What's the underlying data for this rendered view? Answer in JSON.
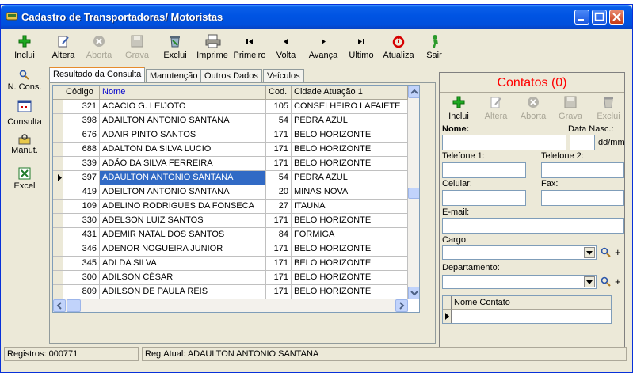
{
  "window": {
    "title": "Cadastro de Transportadoras/ Motoristas"
  },
  "colors": {
    "title_bar": "#0054e3",
    "selection": "#316ac5",
    "contatos_title": "#ff0000",
    "add_icon": "#1ea821",
    "refresh_icon": "#d60000"
  },
  "toolbar": [
    {
      "label": "Inclui",
      "icon": "plus-icon",
      "enabled": true
    },
    {
      "label": "Altera",
      "icon": "edit-icon",
      "enabled": true
    },
    {
      "label": "Aborta",
      "icon": "cancel-icon",
      "enabled": false
    },
    {
      "label": "Grava",
      "icon": "save-icon",
      "enabled": false
    },
    {
      "label": "Exclui",
      "icon": "trash-icon",
      "enabled": true
    },
    {
      "label": "Imprime",
      "icon": "printer-icon",
      "enabled": true
    },
    {
      "label": "Primeiro",
      "icon": "first-icon",
      "enabled": true
    },
    {
      "label": "Volta",
      "icon": "prev-icon",
      "enabled": true
    },
    {
      "label": "Avança",
      "icon": "next-icon",
      "enabled": true
    },
    {
      "label": "Ultimo",
      "icon": "last-icon",
      "enabled": true
    },
    {
      "label": "Atualiza",
      "icon": "refresh-icon",
      "enabled": true
    },
    {
      "label": "Sair",
      "icon": "exit-icon",
      "enabled": true
    }
  ],
  "nav": [
    {
      "label": "N. Cons.",
      "icon": "search-icon"
    },
    {
      "label": "Consulta",
      "icon": "window-icon"
    },
    {
      "label": "Manut.",
      "icon": "tools-icon"
    },
    {
      "label": "Excel",
      "icon": "excel-icon"
    }
  ],
  "tabs": [
    "Resultado da Consulta",
    "Manutenção",
    "Outros Dados",
    "Veículos"
  ],
  "grid": {
    "columns": [
      "Código",
      "Nome",
      "Cod.",
      "Cidade Atuação 1"
    ],
    "rows": [
      [
        "321",
        "ACACIO G. LEIJOTO",
        "105",
        "CONSELHEIRO LAFAIETE"
      ],
      [
        "398",
        "ADAILTON ANTONIO SANTANA",
        "54",
        "PEDRA AZUL"
      ],
      [
        "676",
        "ADAIR PINTO SANTOS",
        "171",
        "BELO HORIZONTE"
      ],
      [
        "688",
        "ADALTON DA SILVA LUCIO",
        "171",
        "BELO HORIZONTE"
      ],
      [
        "339",
        "ADÃO DA SILVA FERREIRA",
        "171",
        "BELO HORIZONTE"
      ],
      [
        "397",
        "ADAULTON ANTONIO SANTANA",
        "54",
        "PEDRA AZUL"
      ],
      [
        "419",
        "ADEILTON ANTONIO SANTANA",
        "20",
        "MINAS NOVA"
      ],
      [
        "109",
        "ADELINO RODRIGUES DA FONSECA",
        "27",
        "ITAUNA"
      ],
      [
        "330",
        "ADELSON LUIZ SANTOS",
        "171",
        "BELO HORIZONTE"
      ],
      [
        "431",
        "ADEMIR NATAL DOS SANTOS",
        "84",
        "FORMIGA"
      ],
      [
        "346",
        "ADENOR NOGUEIRA JUNIOR",
        "171",
        "BELO HORIZONTE"
      ],
      [
        "345",
        "ADI DA SILVA",
        "171",
        "BELO HORIZONTE"
      ],
      [
        "300",
        "ADILSON CÉSAR",
        "171",
        "BELO HORIZONTE"
      ],
      [
        "809",
        "ADILSON DE PAULA REIS",
        "171",
        "BELO HORIZONTE"
      ]
    ],
    "selected_index": 5
  },
  "contatos": {
    "title": "Contatos (0)",
    "toolbar": [
      {
        "label": "Inclui",
        "icon": "plus-icon",
        "enabled": true
      },
      {
        "label": "Altera",
        "icon": "edit-icon",
        "enabled": false
      },
      {
        "label": "Aborta",
        "icon": "cancel-icon",
        "enabled": false
      },
      {
        "label": "Grava",
        "icon": "save-icon",
        "enabled": false
      },
      {
        "label": "Exclui",
        "icon": "trash-icon",
        "enabled": false
      }
    ],
    "labels": {
      "nome": "Nome:",
      "data_nasc": "Data Nasc.:",
      "ddmm": "dd/mm",
      "telefone1": "Telefone 1:",
      "telefone2": "Telefone 2:",
      "celular": "Celular:",
      "fax": "Fax:",
      "email": "E-mail:",
      "cargo": "Cargo:",
      "departamento": "Departamento:",
      "nome_contato": "Nome Contato"
    },
    "plus": "+"
  },
  "status": {
    "registros": "Registros: 000771",
    "reg_atual": "Reg.Atual: ADAULTON ANTONIO SANTANA"
  }
}
